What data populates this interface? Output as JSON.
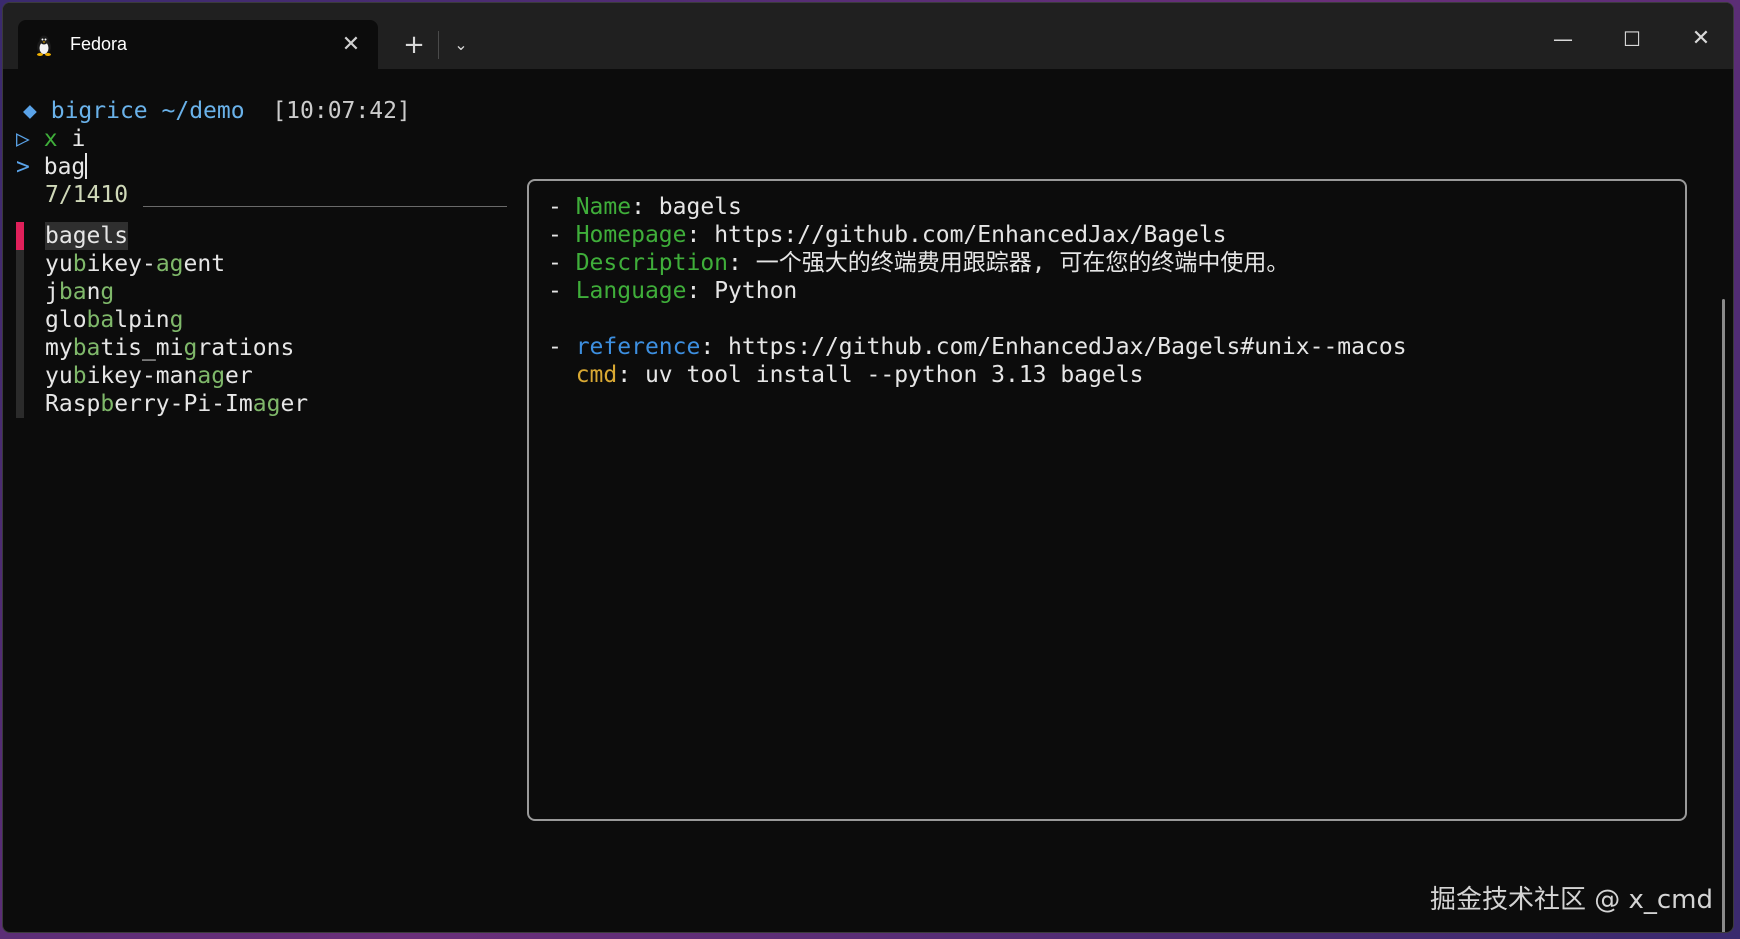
{
  "window": {
    "tab_title": "Fedora",
    "tab_icon": "linux-penguin-icon",
    "new_tab": "+",
    "dropdown": "⌄",
    "minimize": "—",
    "maximize": "☐",
    "close": "✕",
    "tab_close": "✕"
  },
  "prompt": {
    "diamond": "◆",
    "user": "bigrice",
    "path": "~/demo",
    "time": "[10:07:42]",
    "arrow": "▷",
    "cmd_x": "x",
    "cmd_i": "i"
  },
  "search": {
    "marker": ">",
    "query": "bag",
    "count": "7/1410"
  },
  "results": [
    {
      "pre": "",
      "m1": "bag",
      "mid": "",
      "m2": "",
      "post": "els"
    },
    {
      "pre": "yu",
      "m1": "b",
      "mid": "ikey-",
      "m2": "ag",
      "post": "ent"
    },
    {
      "pre": "j",
      "m1": "ba",
      "mid": "n",
      "m2": "g",
      "post": ""
    },
    {
      "pre": "glo",
      "m1": "ba",
      "mid": "lpin",
      "m2": "g",
      "post": ""
    },
    {
      "pre": "my",
      "m1": "ba",
      "mid": "tis_mi",
      "m2": "g",
      "post": "rations"
    },
    {
      "pre": "yu",
      "m1": "b",
      "mid": "ikey-man",
      "m2": "ag",
      "post": "er"
    },
    {
      "pre": "Rasp",
      "m1": "b",
      "mid": "erry-Pi-Im",
      "m2": "ag",
      "post": "er"
    }
  ],
  "preview": {
    "name_key": "Name",
    "name_val": "bagels",
    "homepage_key": "Homepage",
    "homepage_val": "https://github.com/EnhancedJax/Bagels",
    "description_key": "Description",
    "description_val": "一个强大的终端费用跟踪器, 可在您的终端中使用。",
    "language_key": "Language",
    "language_val": "Python",
    "reference_key": "reference",
    "reference_val": "https://github.com/EnhancedJax/Bagels#unix--macos",
    "cmd_key": "cmd",
    "cmd_val": "uv tool install --python 3.13 bagels"
  },
  "watermark": "掘金技术社区 @ x_cmd",
  "colors": {
    "highlight_bar": "#e0205a",
    "key_green": "#3fae3a",
    "key_blue": "#3d8fe0",
    "key_yellow": "#d9a933"
  }
}
